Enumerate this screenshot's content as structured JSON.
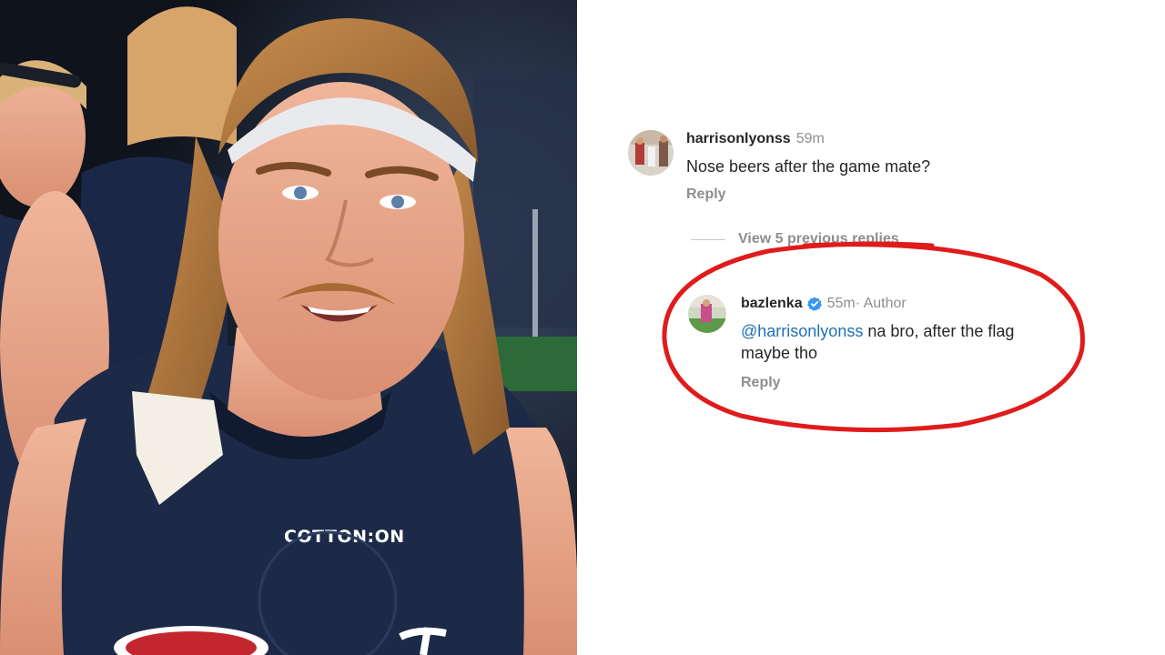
{
  "comments": {
    "parent": {
      "username": "harrisonlyonss",
      "time": "59m",
      "text": "Nose beers after the game mate?",
      "reply_label": "Reply",
      "avatar_icon": "user-avatar-icon"
    },
    "view_replies_label": "View 5 previous replies",
    "reply": {
      "username": "bazlenka",
      "verified_icon": "verified-badge-icon",
      "time": "55m",
      "author_tag": " · Author",
      "mention": "@harrisonlyonss",
      "text_line1": " na bro, after the flag",
      "text_line2": "maybe tho",
      "reply_label": "Reply",
      "avatar_icon": "user-avatar-icon"
    }
  },
  "photo": {
    "jersey_sponsor": "COTTON:ON"
  },
  "colors": {
    "highlight_ring": "#e01b1b",
    "mention": "#1e6fb3",
    "verified": "#3897f0",
    "muted_text": "#8e8e8e",
    "jersey": "#1c2a48"
  }
}
